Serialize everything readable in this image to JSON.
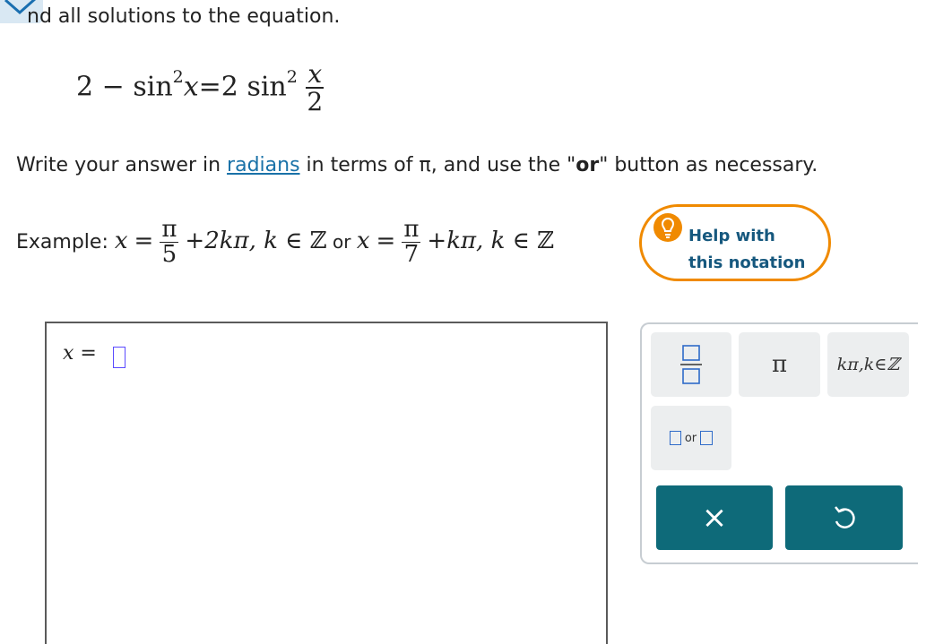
{
  "instructions": {
    "prompt_partial": "nd all solutions to the equation.",
    "equation": {
      "lhs_constant": "2",
      "minus": "−",
      "func1": "sin",
      "exp1": "2",
      "var1": "x",
      "equals": "=",
      "coef": "2",
      "func2": "sin",
      "exp2": "2",
      "num": "x",
      "den": "2"
    },
    "write": {
      "before_link": "Write your answer in ",
      "link": "radians",
      "middle": " in terms of π, and use the \"",
      "or_word": "or",
      "after": "\" button as necessary."
    }
  },
  "example": {
    "label": "Example:",
    "x1": "x",
    "eq1": "=",
    "num1": "π",
    "den1": "5",
    "term1": "+2kπ, ",
    "k1": "k",
    "in1": " ∈ ℤ",
    "or": " or ",
    "x2": "x",
    "eq2": "=",
    "num2": "π",
    "den2": "7",
    "term2": "+kπ, ",
    "k2": "k",
    "in2": " ∈ ℤ"
  },
  "help": {
    "line1": "Help with",
    "line2": "this notation",
    "accent": "#f08a00"
  },
  "answer": {
    "var": "x",
    "eq": "="
  },
  "keypad": {
    "fraction_icon": "fraction-icon",
    "pi_label": "π",
    "kpi_label": "kπ,k∈ℤ",
    "or_label": "or",
    "clear_label": "×",
    "undo_icon": "undo-icon",
    "accent": "#0e6a79"
  }
}
